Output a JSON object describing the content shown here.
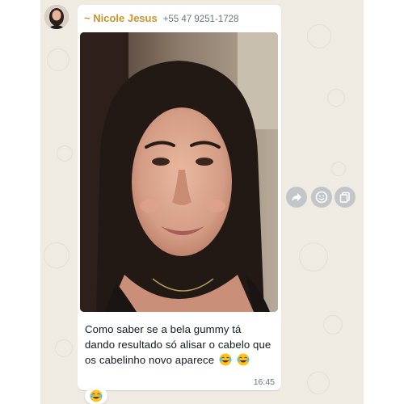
{
  "sender": {
    "prefix": "~",
    "name": "Nicole Jesus",
    "phone": "+55 47 9251-1728"
  },
  "message": {
    "text": "Como saber se a bela gummy tá dando resultado só alisar o cabelo que os cabelinho novo aparece",
    "emojis": [
      "face-with-tears-of-joy-icon",
      "face-with-tears-of-joy-icon"
    ],
    "time": "16:45",
    "media": "photo"
  },
  "reaction": {
    "emoji": "face-with-tears-of-joy-icon"
  },
  "actions": [
    {
      "name": "forward-icon"
    },
    {
      "name": "react-emoji-icon"
    },
    {
      "name": "copy-icon"
    }
  ],
  "colors": {
    "chat_background": "#efeae2",
    "bubble": "#ffffff",
    "sender_name": "#c9932c",
    "meta_text": "#667781",
    "message_text": "#111b21",
    "action_button": "#c3c6c8"
  }
}
